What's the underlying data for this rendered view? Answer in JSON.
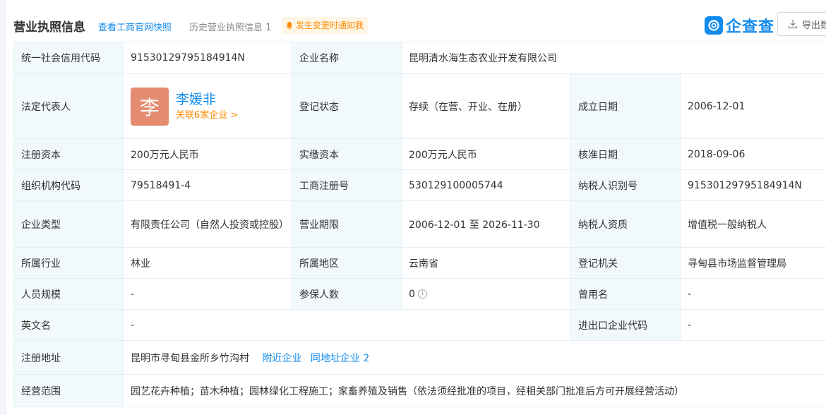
{
  "header": {
    "title": "营业执照信息",
    "snapshot_link": "查看工商官网快照",
    "history_label": "历史营业执照信息",
    "history_count": "1",
    "notify_label": "发生变更时通知我",
    "brand": "企查查",
    "export_label": "导出数"
  },
  "colors": {
    "accent": "#128bed",
    "warning": "#fd8a00",
    "avatar_bg": "#e48c6f",
    "label_bg": "#f2f9fc"
  },
  "rows": {
    "credit_code_label": "统一社会信用代码",
    "credit_code_value": "91530129795184914N",
    "company_name_label": "企业名称",
    "company_name_value": "昆明清水海生态农业开发有限公司",
    "legal_rep_label": "法定代表人",
    "legal_rep_avatar_char": "李",
    "legal_rep_name": "李媛非",
    "legal_rep_related": "关联6家企业 >",
    "reg_status_label": "登记状态",
    "reg_status_value": "存续（在营、开业、在册）",
    "founded_label": "成立日期",
    "founded_value": "2006-12-01",
    "reg_capital_label": "注册资本",
    "reg_capital_value": "200万元人民币",
    "paid_capital_label": "实缴资本",
    "paid_capital_value": "200万元人民币",
    "approval_date_label": "核准日期",
    "approval_date_value": "2018-09-06",
    "org_code_label": "组织机构代码",
    "org_code_value": "79518491-4",
    "biz_reg_no_label": "工商注册号",
    "biz_reg_no_value": "530129100005744",
    "taxpayer_id_label": "纳税人识别号",
    "taxpayer_id_value": "91530129795184914N",
    "company_type_label": "企业类型",
    "company_type_value": "有限责任公司（自然人投资或控股）",
    "biz_term_label": "营业期限",
    "biz_term_value": "2006-12-01 至 2026-11-30",
    "taxpayer_qual_label": "纳税人资质",
    "taxpayer_qual_value": "增值税一般纳税人",
    "industry_label": "所属行业",
    "industry_value": "林业",
    "region_label": "所属地区",
    "region_value": "云南省",
    "reg_authority_label": "登记机关",
    "reg_authority_value": "寻甸县市场监督管理局",
    "staff_size_label": "人员规模",
    "staff_size_value": "-",
    "insured_label": "参保人数",
    "insured_value": "0",
    "former_name_label": "曾用名",
    "former_name_value": "-",
    "english_name_label": "英文名",
    "english_name_value": "-",
    "import_export_label": "进出口企业代码",
    "import_export_value": "-",
    "address_label": "注册地址",
    "address_value": "昆明市寻甸县金所乡竹沟村",
    "nearby_link": "附近企业",
    "same_address_link": "同地址企业",
    "same_address_count": "2",
    "scope_label": "经营范围",
    "scope_value": "园艺花卉种植；苗木种植；园林绿化工程施工；家畜养殖及销售（依法须经批准的项目，经相关部门批准后方可开展经营活动）"
  }
}
